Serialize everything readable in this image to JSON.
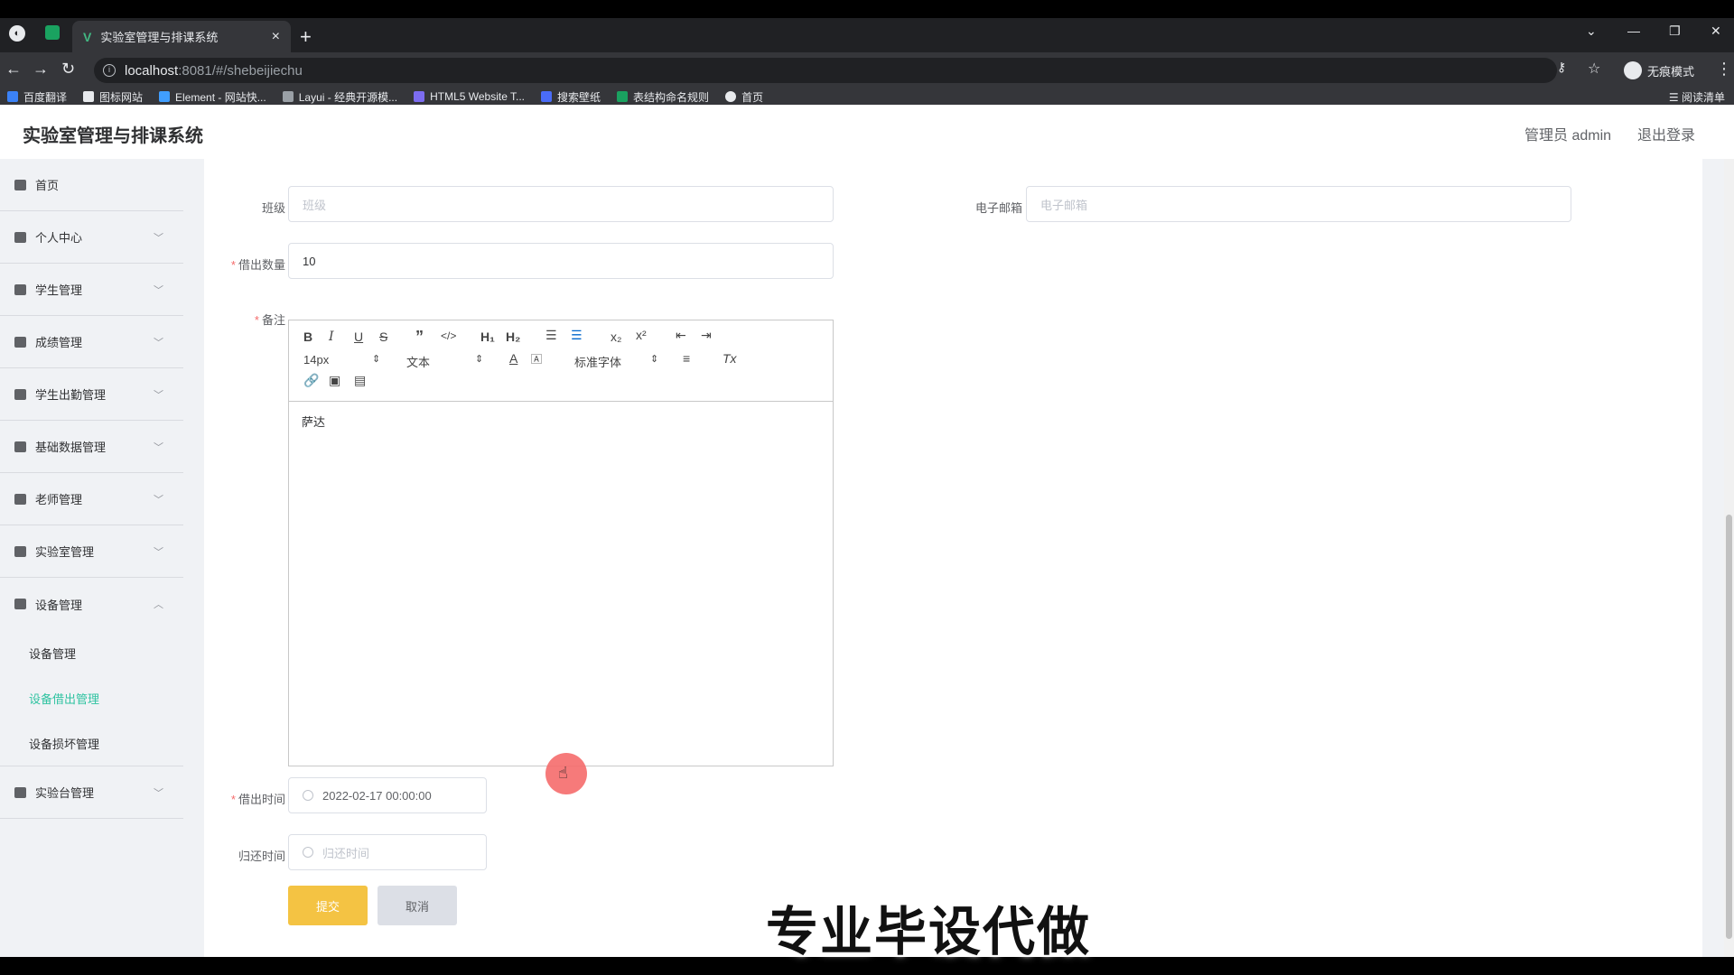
{
  "browser": {
    "tab_title": "实验室管理与排课系统",
    "url_host": "localhost",
    "url_path": ":8081/#/shebeijiechu",
    "incognito_label": "无痕模式",
    "reading_list_label": "阅读清单",
    "bookmarks": [
      "百度翻译",
      "图标网站",
      "Element - 网站快...",
      "Layui - 经典开源模...",
      "HTML5 Website T...",
      "搜索壁纸",
      "表结构命名规则",
      "首页"
    ]
  },
  "header": {
    "brand": "实验室管理与排课系统",
    "user": "管理员 admin",
    "logout": "退出登录"
  },
  "sidebar": {
    "items": [
      {
        "label": "首页"
      },
      {
        "label": "个人中心"
      },
      {
        "label": "学生管理"
      },
      {
        "label": "成绩管理"
      },
      {
        "label": "学生出勤管理"
      },
      {
        "label": "基础数据管理"
      },
      {
        "label": "老师管理"
      },
      {
        "label": "实验室管理"
      },
      {
        "label": "设备管理"
      },
      {
        "label": "实验台管理"
      }
    ],
    "submenu": [
      {
        "label": "设备管理"
      },
      {
        "label": "设备借出管理"
      },
      {
        "label": "设备损坏管理"
      }
    ]
  },
  "form": {
    "class_label": "班级",
    "class_placeholder": "班级",
    "email_label": "电子邮箱",
    "email_placeholder": "电子邮箱",
    "qty_label": "借出数量",
    "qty_value": "10",
    "remark_label": "备注",
    "remark_value": "萨达",
    "editor": {
      "font_size": "14px",
      "text_format": "文本",
      "font_family": "标准字体"
    },
    "borrow_time_label": "借出时间",
    "borrow_time_value": "2022-02-17 00:00:00",
    "return_time_label": "归还时间",
    "return_time_placeholder": "归还时间",
    "submit": "提交",
    "cancel": "取消"
  },
  "overlay": {
    "watermark": "专业毕设代做"
  },
  "colors": {
    "accent": "#2fc3a1",
    "submit": "#f4c343",
    "required": "#f56c6c"
  }
}
